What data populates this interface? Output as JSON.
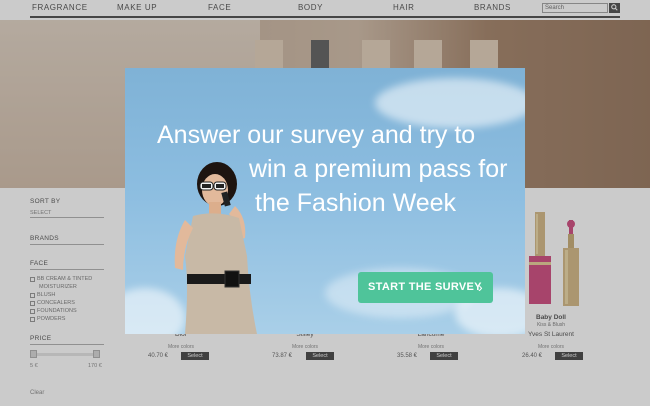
{
  "nav": {
    "items": [
      "FRAGRANCE",
      "MAKE UP",
      "FACE",
      "BODY",
      "HAIR",
      "BRANDS"
    ],
    "search_placeholder": "Search"
  },
  "filters": {
    "sort_by": "SORT BY",
    "sort_select": "SELECT",
    "brands": "BRANDS",
    "face": "FACE",
    "face_options": [
      "BB CREAM & TINTED",
      "MOISTURIZER",
      "BLUSH",
      "CONCEALERS",
      "FOUNDATIONS",
      "POWDERS"
    ],
    "price": "PRICE",
    "price_min": "5 €",
    "price_max": "170 €",
    "clear": "Clear"
  },
  "products": [
    {
      "name": "Dior",
      "more": "More colors",
      "price": "40.70 €",
      "button": "Select"
    },
    {
      "name": "Sisley",
      "more": "More colors",
      "price": "73.87 €",
      "button": "Select"
    },
    {
      "name": "Lancôme",
      "more": "More colors",
      "price": "35.58 €",
      "button": "Select"
    },
    {
      "name": "Baby Doll",
      "sub": "Kiss & Blush",
      "brand": "Yves St Laurent",
      "more": "More colors",
      "price": "26.40 €",
      "button": "Select"
    }
  ],
  "modal": {
    "headline_line1": "Answer our survey and try to",
    "headline_line2": "win a premium pass for",
    "headline_line3": "the Fashion Week",
    "cta_label": "START THE SURVEY",
    "cta_icon": "chevron-right-icon",
    "accent": "#4fc49a"
  }
}
